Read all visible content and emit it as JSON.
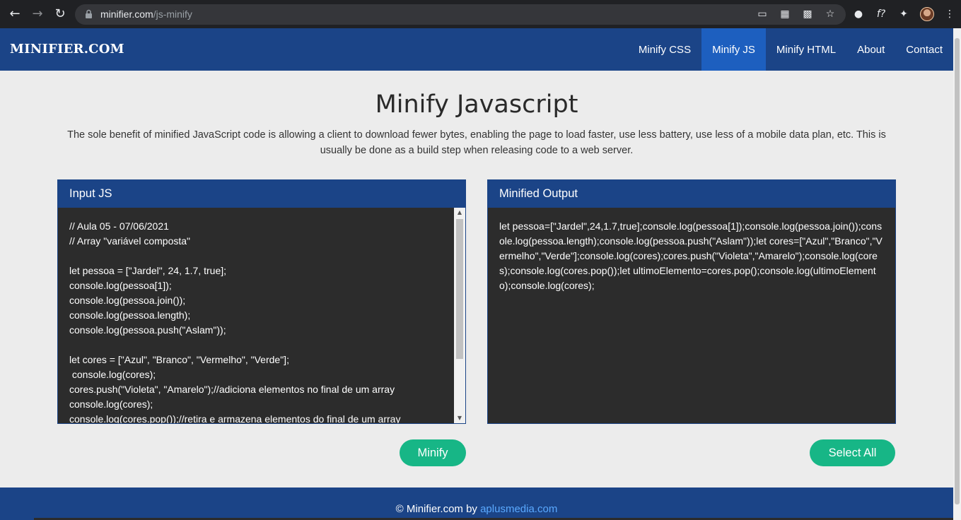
{
  "browser": {
    "url_host": "minifier.com",
    "url_path": "/js-minify",
    "icons": [
      "back-icon",
      "forward-icon",
      "reload-icon",
      "lock-icon",
      "cast-icon",
      "qr-icon",
      "translate-icon",
      "star-icon",
      "extension-icon",
      "formula-icon",
      "puzzle-icon",
      "avatar",
      "menu-icon"
    ]
  },
  "navbar": {
    "brand": "MINIFIER.COM",
    "links": [
      {
        "label": "Minify CSS"
      },
      {
        "label": "Minify JS"
      },
      {
        "label": "Minify HTML"
      },
      {
        "label": "About"
      },
      {
        "label": "Contact"
      }
    ],
    "active": "Minify JS"
  },
  "main": {
    "title": "Minify Javascript",
    "description": "The sole benefit of minified JavaScript code is allowing a client to download fewer bytes, enabling the page to load faster, use less battery, use less of a mobile data plan, etc. This is usually be done as a build step when releasing code to a web server."
  },
  "input_panel": {
    "header": "Input JS",
    "code": "// Aula 05 - 07/06/2021\n// Array \"variável composta\"\n\nlet pessoa = [\"Jardel\", 24, 1.7, true];\nconsole.log(pessoa[1]);\nconsole.log(pessoa.join());\nconsole.log(pessoa.length);\nconsole.log(pessoa.push(\"Aslam\"));\n\nlet cores = [\"Azul\", \"Branco\", \"Vermelho\", \"Verde\"];\n console.log(cores);\ncores.push(\"Violeta\", \"Amarelo\");//adiciona elementos no final de um array\nconsole.log(cores);\nconsole.log(cores.pop());//retira e armazena elementos do final de um array"
  },
  "output_panel": {
    "header": "Minified Output",
    "code": "let pessoa=[\"Jardel\",24,1.7,true];console.log(pessoa[1]);console.log(pessoa.join());console.log(pessoa.length);console.log(pessoa.push(\"Aslam\"));let cores=[\"Azul\",\"Branco\",\"Vermelho\",\"Verde\"];console.log(cores);cores.push(\"Violeta\",\"Amarelo\");console.log(cores);console.log(cores.pop());let ultimoElemento=cores.pop();console.log(ultimoElemento);console.log(cores);"
  },
  "buttons": {
    "minify": "Minify",
    "select_all": "Select All"
  },
  "footer": {
    "prefix": "© Minifier.com by ",
    "link": "aplusmedia.com"
  },
  "colors": {
    "navbar": "#1b4487",
    "nav_active": "#1d5fbf",
    "button": "#17b686",
    "panel_bg": "#2c2c2c"
  }
}
